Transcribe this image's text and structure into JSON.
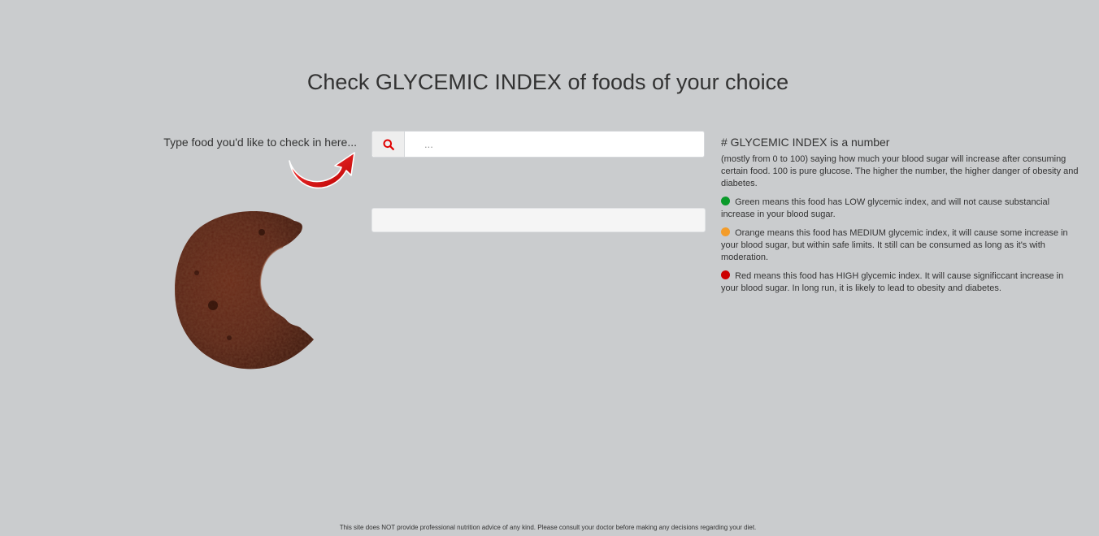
{
  "page": {
    "title": "Check GLYCEMIC INDEX of foods of your choice",
    "background": "#caccce"
  },
  "search": {
    "label": "Type food you'd like to check in here...",
    "placeholder": "...",
    "value": "",
    "icon": "search-icon",
    "icon_color": "#e00000"
  },
  "result": {
    "value": ""
  },
  "info": {
    "heading": "# GLYCEMIC INDEX is a number",
    "description": "(mostly from 0 to 100) saying how much your blood sugar will increase after consuming certain food. 100 is pure glucose. The higher the number, the higher danger of obesity and diabetes.",
    "items": [
      {
        "color": "#0a9a2a",
        "text": "Green means this food has LOW glycemic index, and will not cause substancial increase in your blood sugar."
      },
      {
        "color": "#f39c2a",
        "text": "Orange means this food has MEDIUM glycemic index, it will cause some increase in your blood sugar, but within safe limits. It still can be consumed as long as it's with moderation."
      },
      {
        "color": "#cc0000",
        "text": "Red means this food has HIGH glycemic index. It will cause significcant increase in your blood sugar. In long run, it is likely to lead to obesity and diabetes."
      }
    ]
  },
  "footer": {
    "disclaimer": "This site does NOT provide professional nutrition advice of any kind. Please consult your doctor before making any decisions regarding your diet."
  }
}
